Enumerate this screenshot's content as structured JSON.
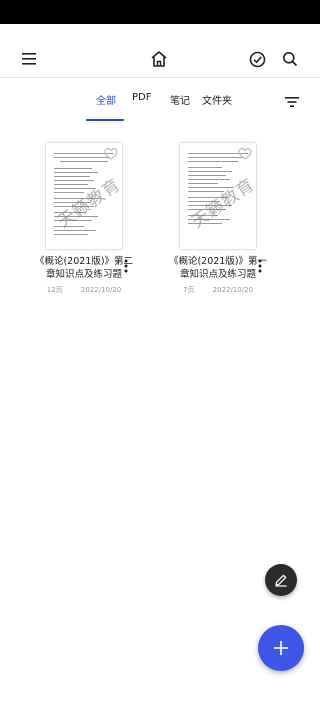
{
  "tabs": [
    {
      "label": "全部",
      "active": true
    },
    {
      "label": "PDF",
      "active": false
    },
    {
      "label": "笔记",
      "active": false
    },
    {
      "label": "文件夹",
      "active": false
    }
  ],
  "documents": [
    {
      "title": "《概论(2021版)》第二章知识点及练习题",
      "pages": "12页",
      "date": "2022/10/20",
      "watermark": "天籁教育"
    },
    {
      "title": "《概论(2021版)》第一章知识点及练习题",
      "pages": "7页",
      "date": "2022/10/20",
      "watermark": "天籁教育"
    }
  ],
  "colors": {
    "accent": "#2f49d1",
    "fab_add": "#3f57e6",
    "fab_edit": "#2b2b2b"
  },
  "icons": [
    "menu-icon",
    "home-icon",
    "check-circle-icon",
    "search-icon",
    "filter-icon",
    "heart-icon",
    "more-vert-icon",
    "edit-icon",
    "plus-icon"
  ]
}
